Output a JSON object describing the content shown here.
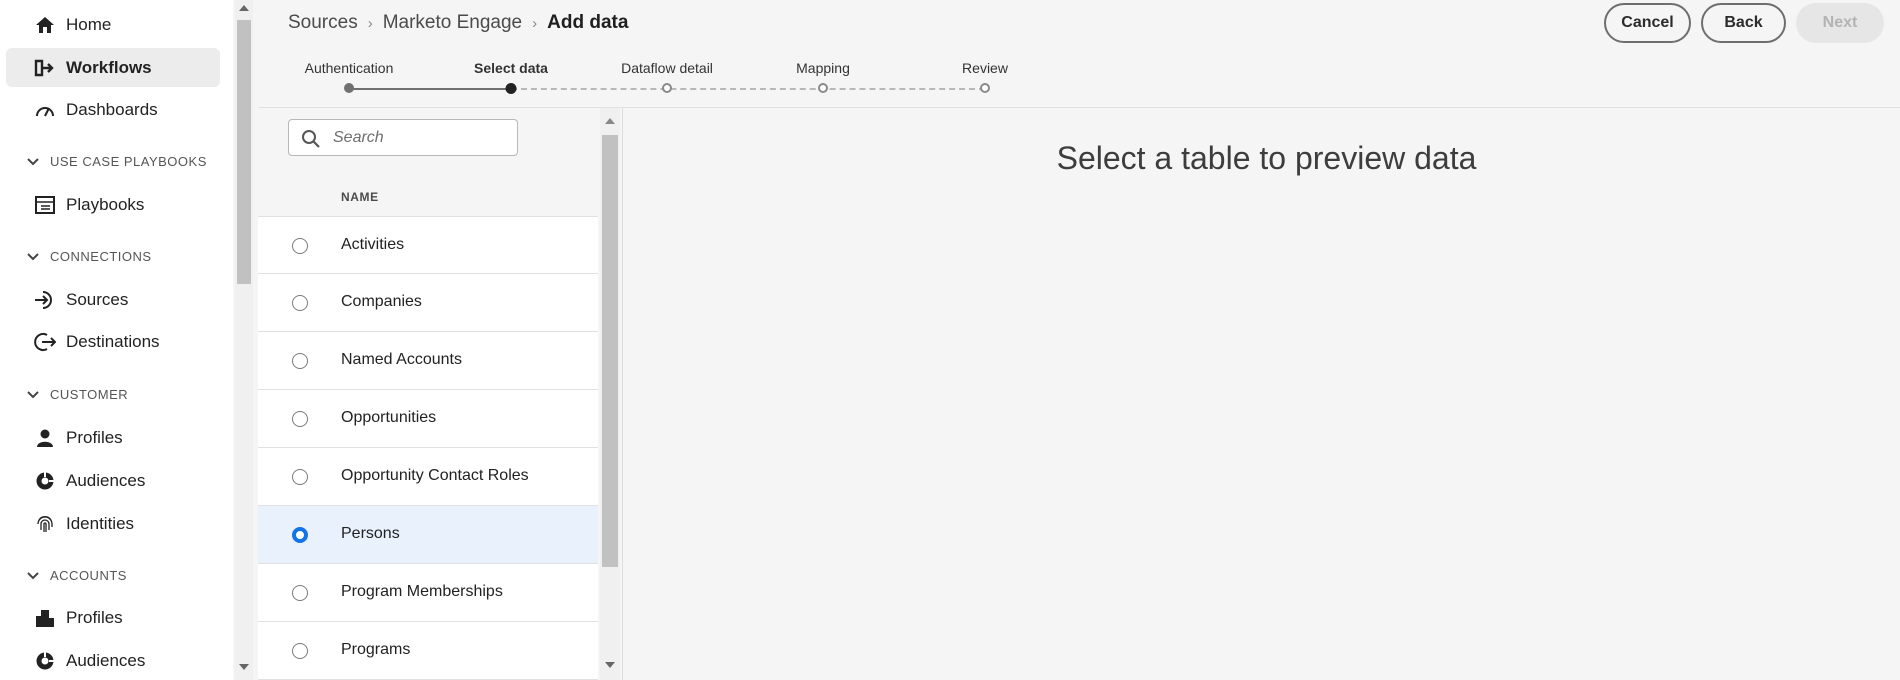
{
  "sidebar": {
    "items": [
      {
        "label": "Home",
        "icon": "home-icon"
      },
      {
        "label": "Workflows",
        "icon": "workflow-icon",
        "active": true
      },
      {
        "label": "Dashboards",
        "icon": "dashboard-icon"
      },
      {
        "label": "Playbooks",
        "icon": "playbook-icon"
      },
      {
        "label": "Sources",
        "icon": "sources-icon"
      },
      {
        "label": "Destinations",
        "icon": "destinations-icon"
      },
      {
        "label": "Profiles",
        "icon": "user-icon"
      },
      {
        "label": "Audiences",
        "icon": "audiences-icon"
      },
      {
        "label": "Identities",
        "icon": "fingerprint-icon"
      },
      {
        "label": "Profiles",
        "icon": "building-icon"
      },
      {
        "label": "Audiences",
        "icon": "audiences-icon"
      }
    ],
    "sections": [
      "USE CASE PLAYBOOKS",
      "CONNECTIONS",
      "CUSTOMER",
      "ACCOUNTS"
    ]
  },
  "breadcrumb": {
    "items": [
      "Sources",
      "Marketo Engage"
    ],
    "current": "Add data"
  },
  "actions": {
    "cancel": "Cancel",
    "back": "Back",
    "next": "Next"
  },
  "stepper": {
    "steps": [
      "Authentication",
      "Select data",
      "Dataflow detail",
      "Mapping",
      "Review"
    ],
    "current_index": 1
  },
  "list": {
    "search_placeholder": "Search",
    "column_header": "NAME",
    "rows": [
      "Activities",
      "Companies",
      "Named Accounts",
      "Opportunities",
      "Opportunity Contact Roles",
      "Persons",
      "Program Memberships",
      "Programs"
    ],
    "selected": "Persons"
  },
  "preview": {
    "message": "Select a table to preview data"
  },
  "colors": {
    "accent": "#1473e6",
    "selected_row": "#e8f1fc",
    "active_nav": "#ececec"
  }
}
